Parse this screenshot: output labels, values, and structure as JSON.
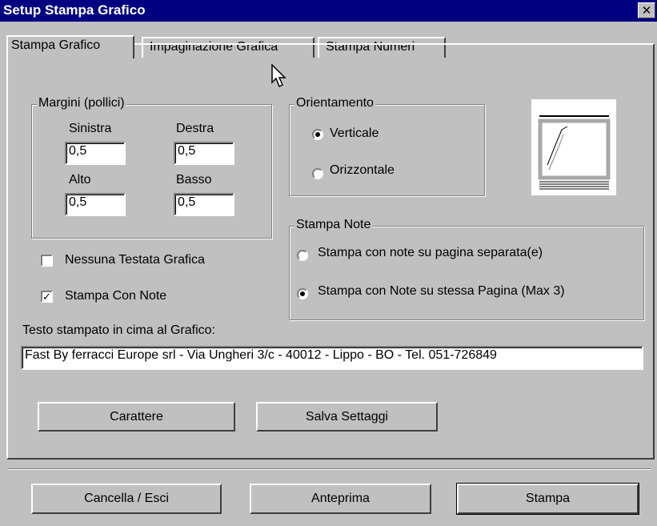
{
  "window": {
    "title": "Setup Stampa Grafico",
    "close_glyph": "✕"
  },
  "tabs": [
    {
      "label": "Stampa Grafico",
      "active": true
    },
    {
      "label": "Impaginazione Grafica",
      "active": false
    },
    {
      "label": "Stampa Numeri",
      "active": false
    }
  ],
  "margins": {
    "group_label": "Margini (pollici)",
    "left_label": "Sinistra",
    "left_value": "0,5",
    "right_label": "Destra",
    "right_value": "0,5",
    "top_label": "Alto",
    "top_value": "0,5",
    "bottom_label": "Basso",
    "bottom_value": "0,5"
  },
  "orientation": {
    "group_label": "Orientamento",
    "portrait_label": "Verticale",
    "landscape_label": "Orizzontale",
    "selected": "portrait"
  },
  "notes": {
    "group_label": "Stampa Note",
    "separate_label": "Stampa con note su pagina separata(e)",
    "same_label": "Stampa con Note su stessa Pagina (Max 3)",
    "selected": "same"
  },
  "options": {
    "no_header_label": "Nessuna Testata Grafica",
    "no_header_checked": false,
    "print_notes_label": "Stampa Con Note",
    "print_notes_checked": true
  },
  "header_text": {
    "label": "Testo stampato in cima al Grafico:",
    "value": "Fast By ferracci Europe srl - Via Ungheri 3/c - 40012 - Lippo - BO - Tel. 051-726849"
  },
  "buttons": {
    "font": "Carattere",
    "save": "Salva Settaggi",
    "cancel": "Cancella / Esci",
    "preview": "Anteprima",
    "print": "Stampa"
  },
  "colors": {
    "titlebar": "#000080",
    "face": "#c0c0c0"
  }
}
